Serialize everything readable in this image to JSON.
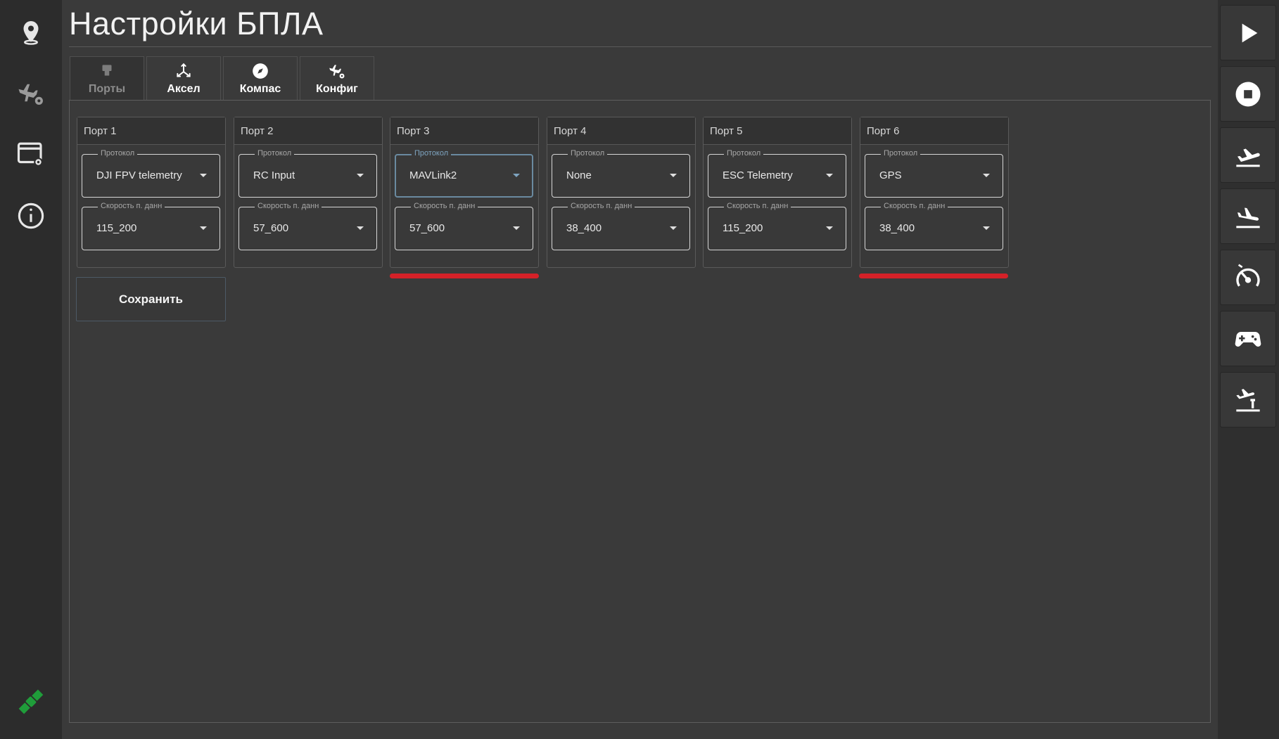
{
  "header": {
    "title": "Настройки БПЛА"
  },
  "tabs": [
    {
      "label": "Порты",
      "icon": "port-connector-icon",
      "active": false
    },
    {
      "label": "Аксел",
      "icon": "axes-icon",
      "active": true
    },
    {
      "label": "Компас",
      "icon": "compass-icon",
      "active": true
    },
    {
      "label": "Конфиг",
      "icon": "plane-gear-icon",
      "active": true
    }
  ],
  "ports": [
    {
      "title": "Порт 1",
      "protocol_label": "Протокол",
      "protocol": "DJI FPV telemetry",
      "speed_label": "Скорость п. данн",
      "speed": "115_200"
    },
    {
      "title": "Порт 2",
      "protocol_label": "Протокол",
      "protocol": "RC Input",
      "speed_label": "Скорость п. данн",
      "speed": "57_600"
    },
    {
      "title": "Порт 3",
      "protocol_label": "Протокол",
      "protocol": "MAVLink2",
      "speed_label": "Скорость п. данн",
      "speed": "57_600"
    },
    {
      "title": "Порт 4",
      "protocol_label": "Протокол",
      "protocol": "None",
      "speed_label": "Скорость п. данн",
      "speed": "38_400"
    },
    {
      "title": "Порт 5",
      "protocol_label": "Протокол",
      "protocol": "ESC Telemetry",
      "speed_label": "Скорость п. данн",
      "speed": "115_200"
    },
    {
      "title": "Порт 6",
      "protocol_label": "Протокол",
      "protocol": "GPS",
      "speed_label": "Скорость п. данн",
      "speed": "38_400"
    }
  ],
  "save_label": "Сохранить",
  "left_nav": [
    "map-pin-icon",
    "plane-settings-icon",
    "window-settings-icon",
    "info-icon",
    "satellite-icon"
  ],
  "right_rail": [
    "play-icon",
    "stop-icon",
    "takeoff-icon",
    "landing-icon",
    "calibrate-gauge-icon",
    "gamepad-icon",
    "tower-takeoff-icon"
  ],
  "colors": {
    "background": "#3a3a3a",
    "sidebar": "#2c2c2c",
    "focus_outline": "#6a8aa0",
    "highlight_underline": "#d42128",
    "connection_status": "#1f9d3a"
  }
}
